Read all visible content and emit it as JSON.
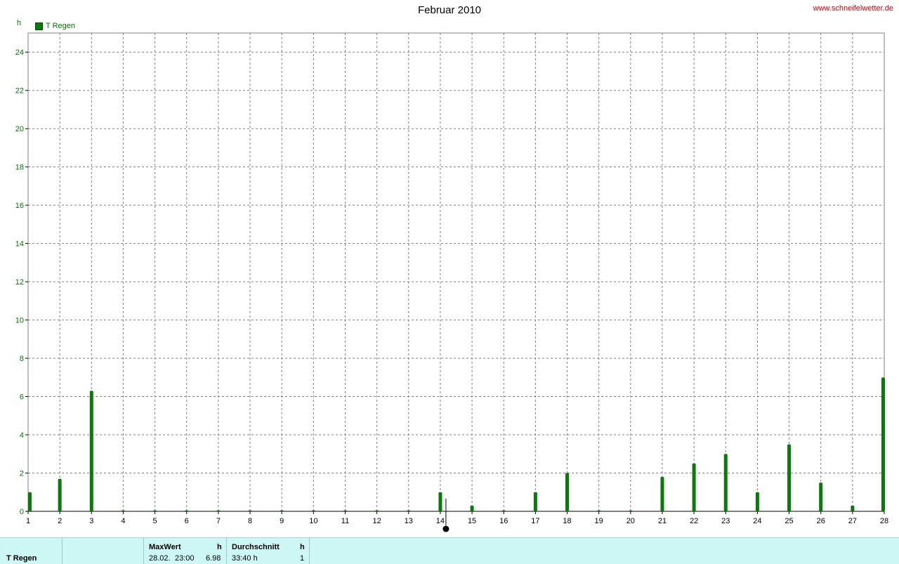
{
  "chart_data": {
    "type": "bar",
    "title": "Februar 2010",
    "ylabel": "h",
    "ylim": [
      0,
      25
    ],
    "yticks": [
      0,
      2,
      4,
      6,
      8,
      10,
      12,
      14,
      16,
      18,
      20,
      22,
      24
    ],
    "categories": [
      "1",
      "2",
      "3",
      "4",
      "5",
      "6",
      "7",
      "8",
      "9",
      "10",
      "11",
      "12",
      "13",
      "14",
      "15",
      "16",
      "17",
      "18",
      "19",
      "20",
      "21",
      "22",
      "23",
      "24",
      "25",
      "26",
      "27",
      "28"
    ],
    "series": [
      {
        "name": "T Regen",
        "color": "#0a7a0a",
        "values": [
          1.0,
          1.7,
          6.3,
          0,
          0,
          0,
          0,
          0,
          0,
          0,
          0,
          0,
          0,
          1.0,
          0.3,
          0,
          1.0,
          2.0,
          0,
          0,
          1.8,
          2.5,
          3.0,
          1.0,
          3.5,
          1.5,
          0.3,
          7.0
        ]
      }
    ],
    "grid": true,
    "legend_position": "top-left",
    "marker_day": "14"
  },
  "site": "www.schneifelwetter.de",
  "footer": {
    "series_name": "T Regen",
    "max_header": "MaxWert",
    "max_unit": "h",
    "max_date": "28.02.",
    "max_time": "23:00",
    "max_value": "6.98",
    "avg_header": "Durchschnitt",
    "avg_unit": "h",
    "avg_value": "33:40 h",
    "avg_count": "1"
  },
  "colors": {
    "axis_text": "#007700",
    "bar": "#0a7a0a",
    "grid": "#808080",
    "footer_bg": "#ccf7f5",
    "site_link": "#cc0000"
  }
}
